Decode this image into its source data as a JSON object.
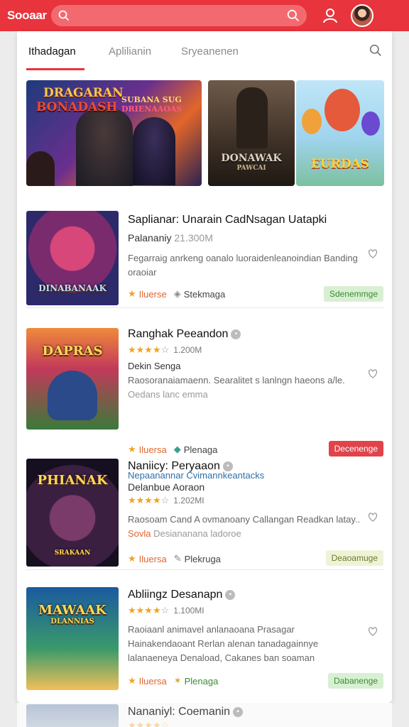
{
  "appbar": {
    "logo": "Sooaar",
    "icons": [
      "search-icon",
      "search-icon",
      "user-icon",
      "avatar"
    ]
  },
  "tabs": [
    {
      "label": "Ithadagan",
      "active": true
    },
    {
      "label": "Aplilianin",
      "active": false
    },
    {
      "label": "Sryeanenen",
      "active": false
    }
  ],
  "banner": [
    {
      "text1": "DRAGARAN",
      "text2": "BONADASH",
      "text3": "SUBANA SUG",
      "text4": "DRIENAAOAS"
    },
    {
      "text1": "DONAWAK",
      "text2": "PAWCAI"
    },
    {
      "text1": "EURDAS"
    }
  ],
  "items": [
    {
      "thumb_text": "DINABANAAK",
      "title": "Saplianar: Unarain CadNsagan Uatapki",
      "sub": "Palananiy",
      "sub_muted": "21.300M",
      "desc": "Fegarraig anrkeng oanalo luoraidenleanoindian Banding oraoiar",
      "meta1": "Iluerse",
      "meta2": "Stekmaga",
      "button": "Sdenemmge",
      "button_style": "green"
    },
    {
      "thumb_text": "DAPRAS",
      "title": "Ranghak Peeandon",
      "rating_count": "1.200M",
      "sub": "Dekin Senga",
      "desc": "Raosoranaiamaenn. Searalitet s lanlngn haeons a/le.",
      "desc2": "Oedans lanc emma",
      "meta1": "Iluersa",
      "meta2": "Plenaga",
      "button": "Decenenge",
      "button_style": "red",
      "link": "Nepaanannar Cvimannkeantacks"
    },
    {
      "thumb_text": "PHIANAK",
      "thumb_sub": "SRAKAAN",
      "title": "Naniicy: Peryaaon",
      "sub": "Delanbue Aoraon",
      "rating_count": "1.202MI",
      "desc": "Raosoam Cand A ovmanoany Callangan Readkan latay..",
      "desc2": "Sovla",
      "desc2b": "Desiananana ladoroe",
      "meta1": "Iluersa",
      "meta2": "Plekruga",
      "button": "Deaoamuge",
      "button_style": "green"
    },
    {
      "thumb_text": "MAWAAK",
      "thumb_sub": "DLANNIAS",
      "title": "Abliingz Desanapn",
      "rating_count": "1.100MI",
      "desc": "Raoiaanl animavel anlanaoana Prasagar Hainakendaoant Rerlan alenan tanadagainnye lalanaeneya Denaload, Cakanes ban soaman",
      "meta1": "Iluersa",
      "meta2": "Plenaga",
      "button": "Dabanenge",
      "button_style": "green"
    },
    {
      "title": "Nananiyl: Coemanin"
    }
  ],
  "colors": {
    "accent": "#e8343d",
    "green_badge": "#d8f0d2",
    "link": "#2e6ea8"
  }
}
